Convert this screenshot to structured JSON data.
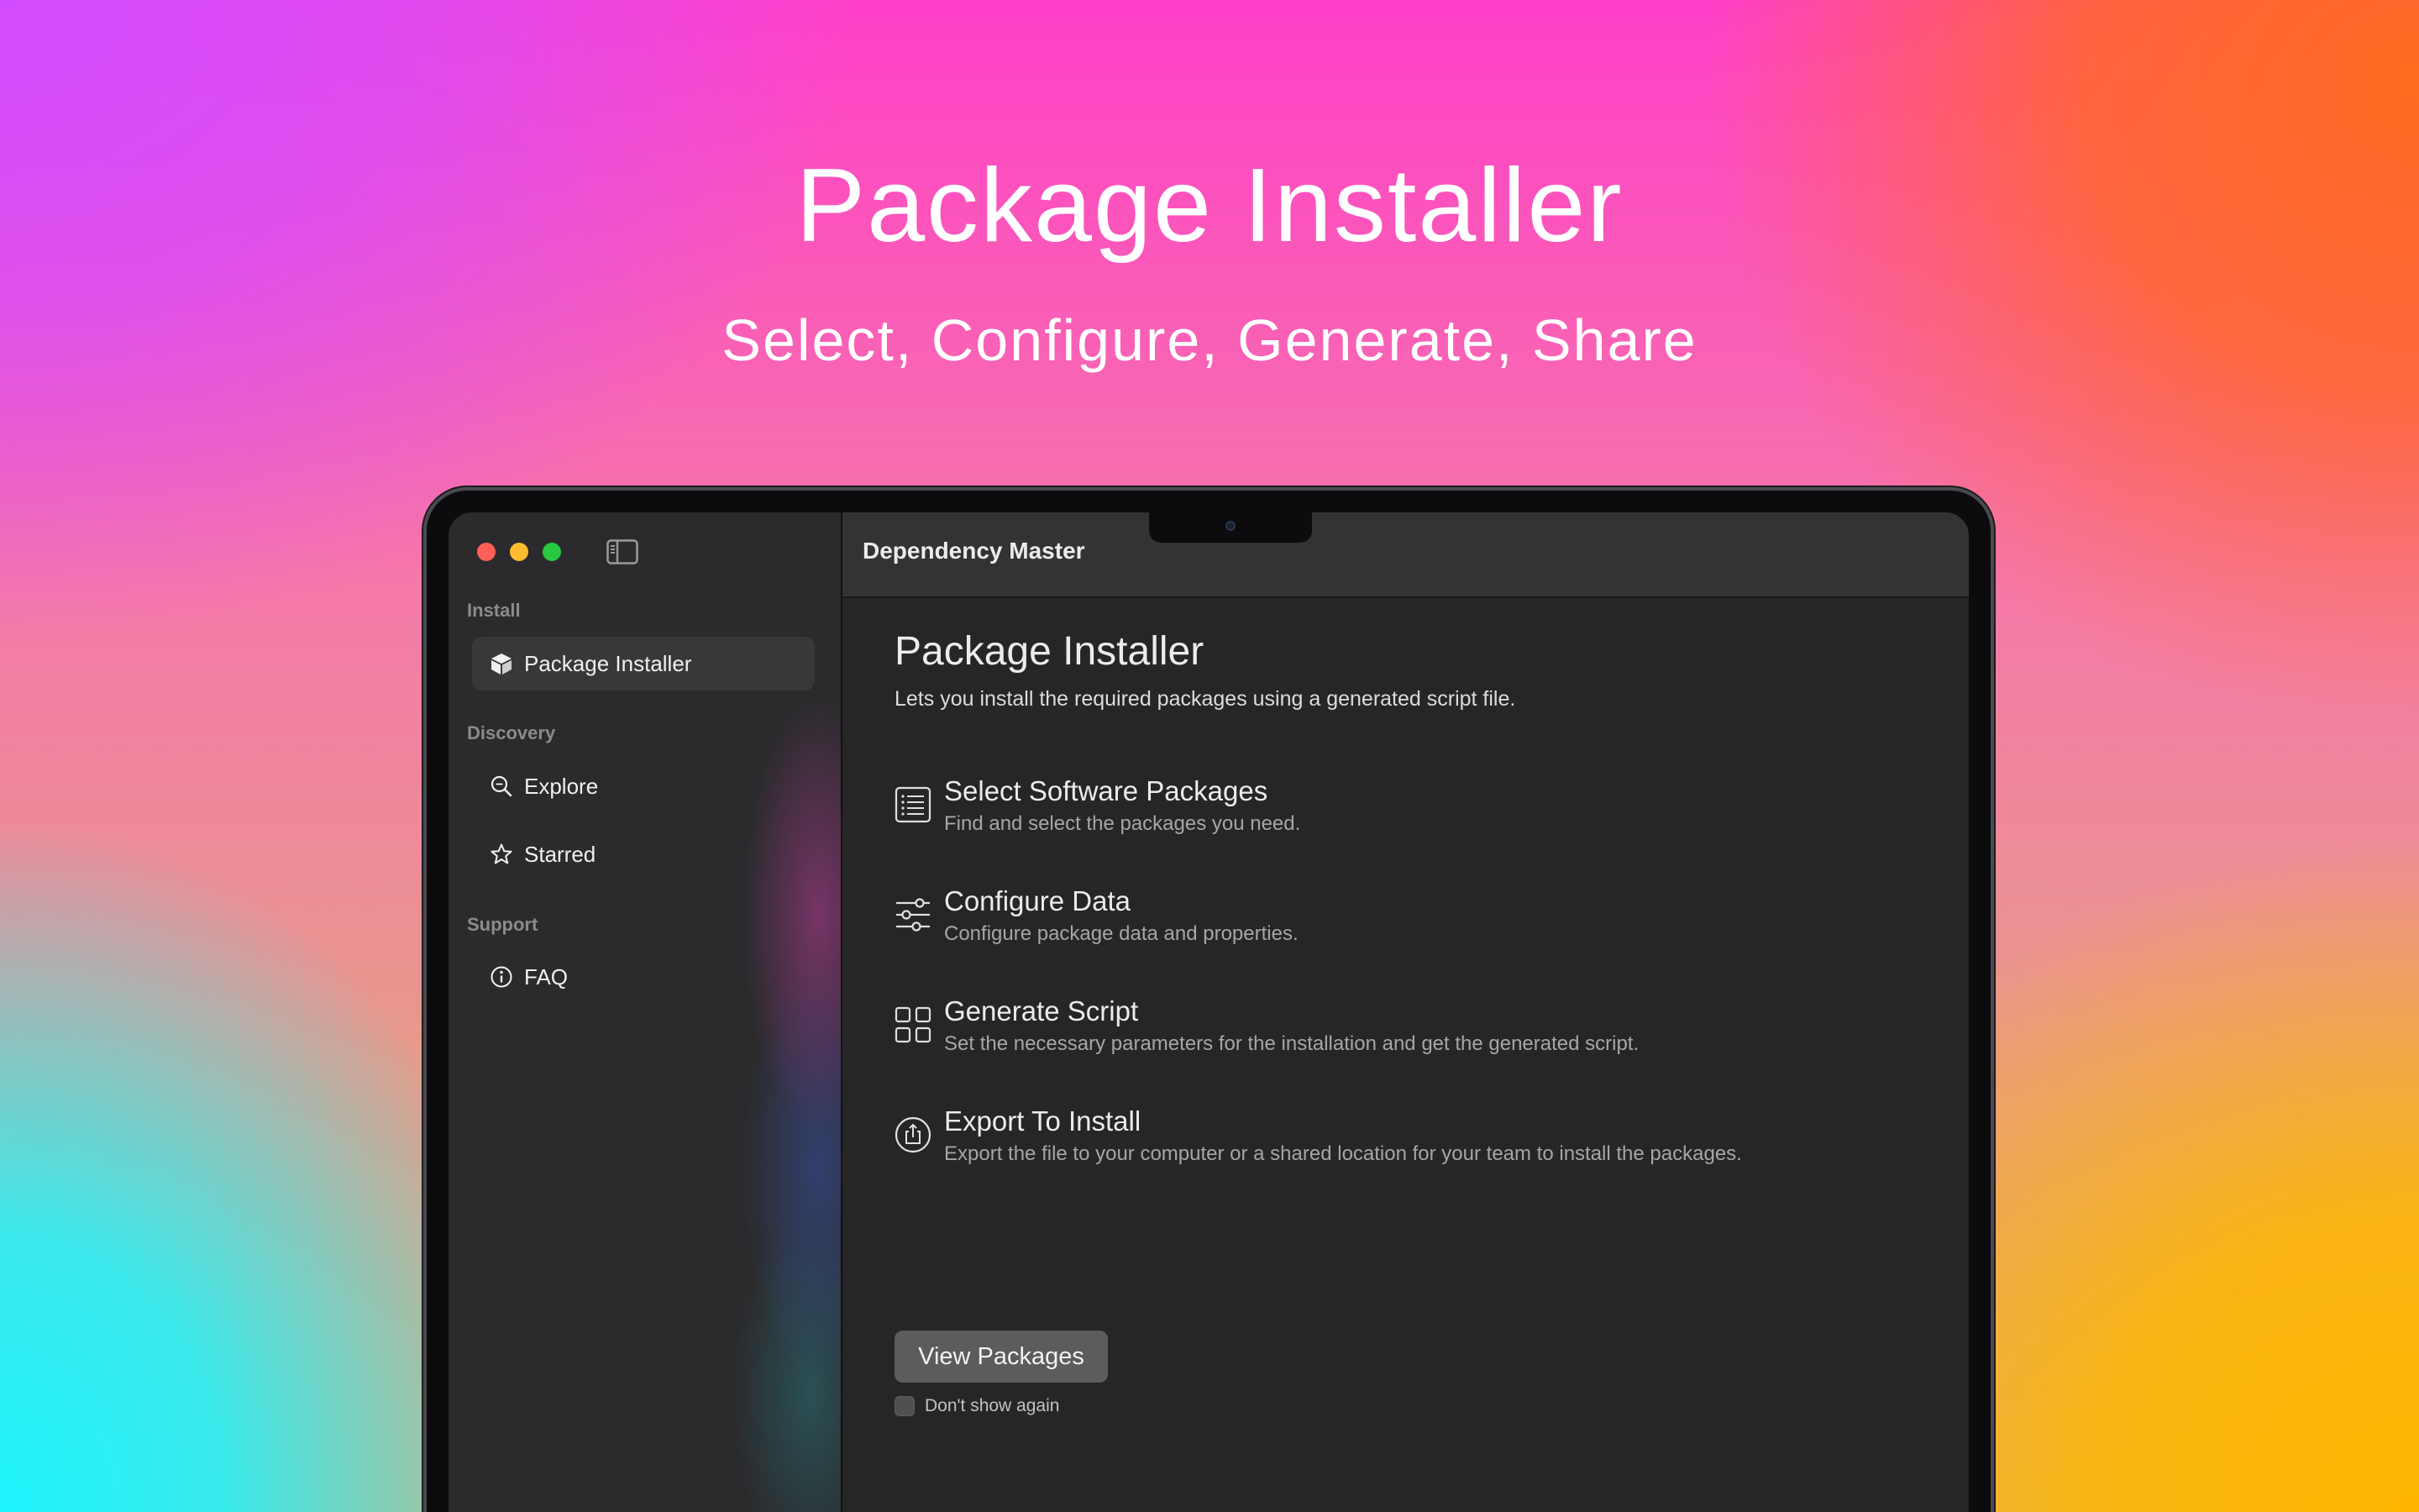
{
  "hero": {
    "title": "Package Installer",
    "subtitle": "Select, Configure, Generate, Share"
  },
  "window": {
    "title": "Dependency Master",
    "controls": [
      "close",
      "minimize",
      "zoom"
    ],
    "sidebar_toggle_icon": "sidebar-toggle-icon"
  },
  "sidebar": {
    "sections": [
      {
        "label": "Install",
        "items": [
          {
            "label": "Package Installer",
            "icon": "package-icon",
            "selected": true
          }
        ]
      },
      {
        "label": "Discovery",
        "items": [
          {
            "label": "Explore",
            "icon": "magnifier-icon"
          },
          {
            "label": "Starred",
            "icon": "star-icon"
          }
        ]
      },
      {
        "label": "Support",
        "items": [
          {
            "label": "FAQ",
            "icon": "info-icon"
          }
        ]
      }
    ]
  },
  "main": {
    "title": "Package Installer",
    "description": "Lets you install the required packages using a generated script file.",
    "features": [
      {
        "title": "Select Software Packages",
        "description": "Find and select the packages you need.",
        "icon": "list-icon"
      },
      {
        "title": "Configure Data",
        "description": "Configure package data and properties.",
        "icon": "sliders-icon"
      },
      {
        "title": "Generate Script",
        "description": "Set the necessary parameters for the installation and get the generated script.",
        "icon": "grid-icon"
      },
      {
        "title": "Export To Install",
        "description": "Export the file to your computer or a shared location for your team to install the packages.",
        "icon": "share-icon"
      }
    ],
    "button_label": "View Packages",
    "checkbox_label": "Don't show again",
    "checkbox_checked": false
  },
  "colors": {
    "close": "#ff5f57",
    "minimize": "#febc2e",
    "zoom": "#28c840",
    "selected_item_bg": "#38383a",
    "button_bg": "#5c5c5e"
  }
}
